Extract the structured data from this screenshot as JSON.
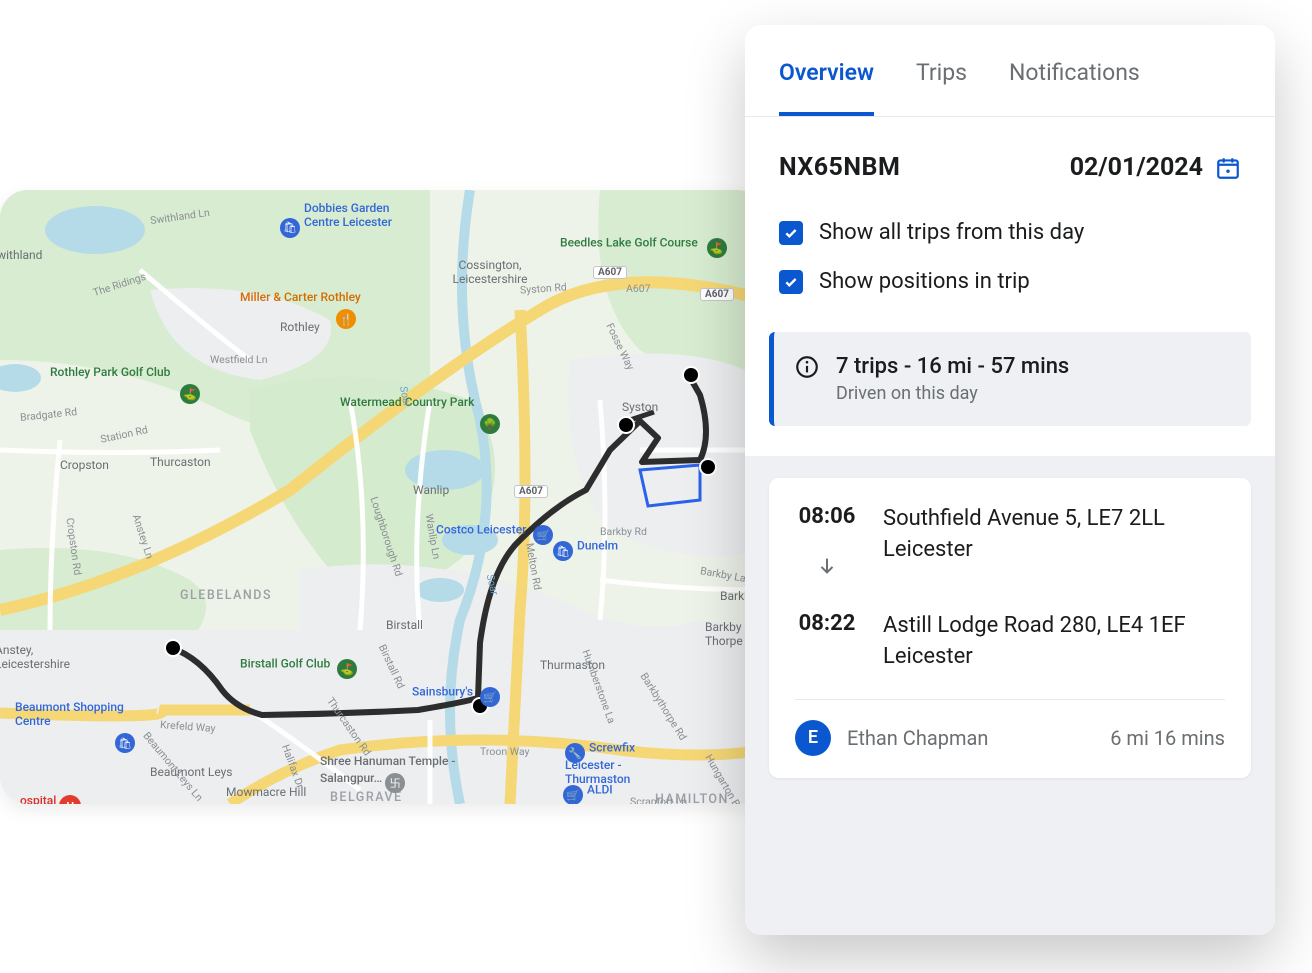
{
  "tabs": [
    {
      "label": "Overview",
      "active": true
    },
    {
      "label": "Trips",
      "active": false
    },
    {
      "label": "Notifications",
      "active": false
    }
  ],
  "vehicle_reg": "NX65NBM",
  "date": "02/01/2024",
  "options": {
    "show_all_trips_label": "Show all trips from this day",
    "show_positions_label": "Show positions in trip"
  },
  "summary": {
    "headline": "7 trips - 16 mi - 57 mins",
    "sub": "Driven on this day"
  },
  "trip": {
    "start": {
      "time": "08:06",
      "address_line1": "Southfield Avenue 5, LE7 2LL",
      "address_line2": "Leicester"
    },
    "end": {
      "time": "08:22",
      "address_line1": "Astill Lodge Road 280, LE4 1EF",
      "address_line2": "Leicester"
    },
    "driver": {
      "initial": "E",
      "name": "Ethan Chapman"
    },
    "stats": "6 mi 16 mins"
  },
  "map": {
    "districts": [
      "GLEBELANDS",
      "BELGRAVE",
      "HAMILTON"
    ],
    "towns": [
      "Swithland",
      "Rothley",
      "Cropston",
      "Thurcaston",
      "Anstey, Leicestershire",
      "Wanlip",
      "Birstall",
      "Cossington, Leicestershire",
      "Syston",
      "Thurmaston",
      "Barkby",
      "Barkby Thorpe",
      "Beaumont Leys",
      "Mowmacre Hill"
    ],
    "pois": {
      "dobbies": "Dobbies Garden Centre Leicester",
      "miller": "Miller & Carter Rothley",
      "rothley_gc": "Rothley Park Golf Club",
      "watermead": "Watermead Country Park",
      "costco": "Costco Leicester",
      "dunelm": "Dunelm",
      "sainsburys": "Sainsbury's",
      "beaumont": "Beaumont Shopping Centre",
      "shree": "Shree Hanuman Temple - Salangpur…",
      "screwfix": "Screwfix Leicester - Thurmaston",
      "aldi": "ALDI",
      "birstall_gc": "Birstall Golf Club",
      "beedles": "Beedles Lake Golf Course",
      "hospital": "ospital"
    },
    "roads": [
      "Swithland Ln",
      "The Ridings",
      "Westfield Ln",
      "Bradgate Rd",
      "Station Rd",
      "Anstey Ln",
      "Cropston Rd",
      "Loughborough Rd",
      "Wanlip Ln",
      "Melton Rd",
      "Birstall Rd",
      "Syston Rd",
      "Fosse Way",
      "Barkby Rd",
      "Barkby La",
      "Humberstone La",
      "Krefeld Way",
      "Beaumont Leys Ln",
      "Halifax Dr",
      "Troon Way",
      "Hungarton Blvd",
      "Scraptoft Ln",
      "Thurcaston Rd",
      "Barkbythorpe Rd",
      "Soar",
      "A607"
    ],
    "shields": [
      "A607"
    ]
  }
}
